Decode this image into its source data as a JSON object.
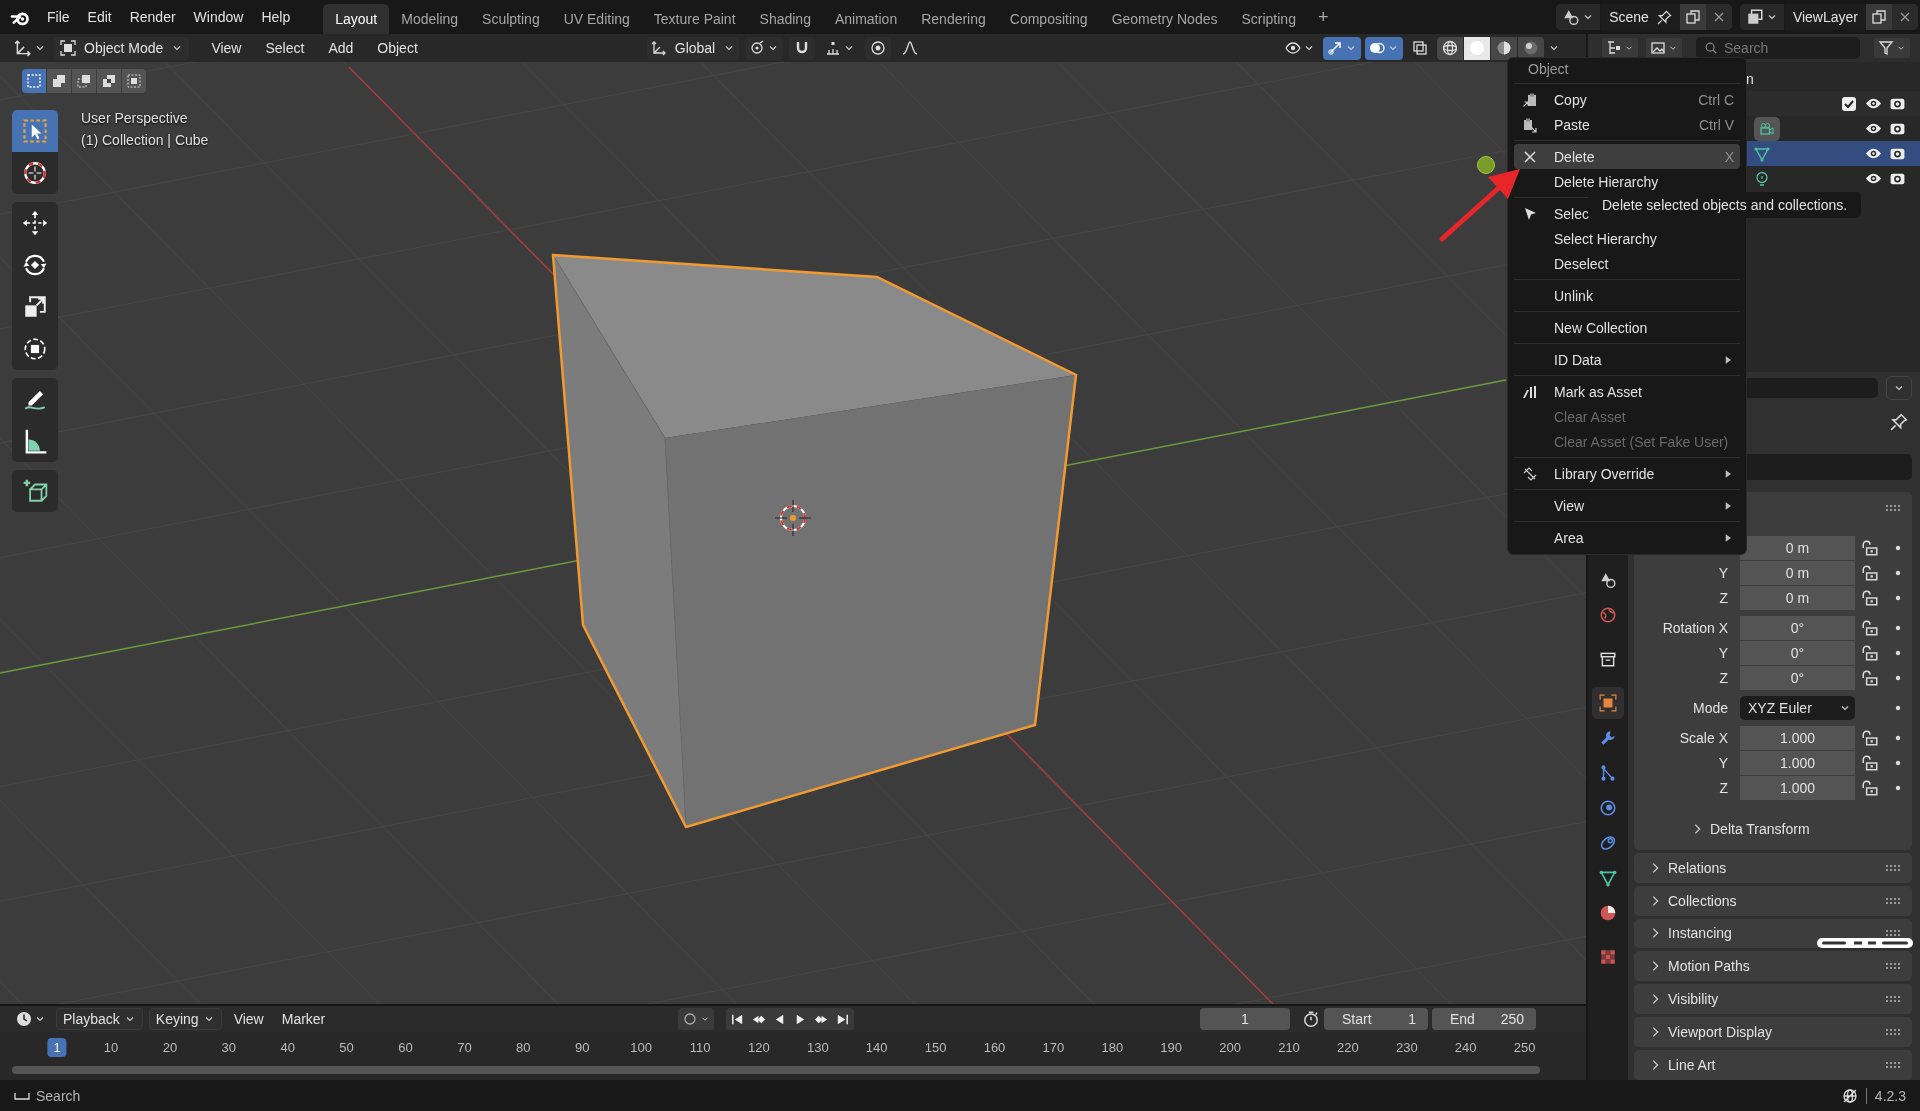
{
  "topbar": {
    "menus": [
      "File",
      "Edit",
      "Render",
      "Window",
      "Help"
    ],
    "workspaces": [
      {
        "label": "Layout",
        "selected": true
      },
      {
        "label": "Modeling",
        "selected": false
      },
      {
        "label": "Sculpting",
        "selected": false
      },
      {
        "label": "UV Editing",
        "selected": false
      },
      {
        "label": "Texture Paint",
        "selected": false
      },
      {
        "label": "Shading",
        "selected": false
      },
      {
        "label": "Animation",
        "selected": false
      },
      {
        "label": "Rendering",
        "selected": false
      },
      {
        "label": "Compositing",
        "selected": false
      },
      {
        "label": "Geometry Nodes",
        "selected": false
      },
      {
        "label": "Scripting",
        "selected": false
      }
    ],
    "add_workspace": "+",
    "scene": "Scene",
    "view_layer": "ViewLayer"
  },
  "viewport": {
    "mode": "Object Mode",
    "menus": [
      "View",
      "Select",
      "Add",
      "Object"
    ],
    "orientation": "Global",
    "toggles": [
      {
        "kind": "visibility",
        "on": false
      },
      {
        "kind": "gizmo",
        "on": true
      },
      {
        "kind": "overlays",
        "on": true
      },
      {
        "kind": "xray",
        "on": false
      }
    ],
    "shading": [
      {
        "kind": "wireframe",
        "selected": false
      },
      {
        "kind": "solid",
        "selected": true
      },
      {
        "kind": "material",
        "selected": false
      },
      {
        "kind": "rendered",
        "selected": false
      }
    ],
    "select_modes": [
      {
        "kind": "new",
        "selected": true
      },
      {
        "kind": "extend",
        "selected": false
      },
      {
        "kind": "subtract",
        "selected": false
      },
      {
        "kind": "invert",
        "selected": false
      },
      {
        "kind": "intersect",
        "selected": false
      }
    ],
    "tool_groups": [
      [
        {
          "kind": "select_box",
          "selected": true
        },
        {
          "kind": "cursor",
          "selected": false
        }
      ],
      [
        {
          "kind": "move",
          "selected": false
        },
        {
          "kind": "rotate",
          "selected": false
        },
        {
          "kind": "scale",
          "selected": false
        },
        {
          "kind": "transform",
          "selected": false
        }
      ],
      [
        {
          "kind": "annotate",
          "selected": false
        },
        {
          "kind": "measure",
          "selected": false
        }
      ],
      [
        {
          "kind": "add_cube",
          "selected": false
        }
      ]
    ],
    "info": [
      "User Perspective",
      "(1) Collection | Cube"
    ]
  },
  "context_menu": {
    "title": "Object",
    "sections": [
      [
        {
          "label": "Copy",
          "shortcut": "Ctrl C",
          "kind": "copy",
          "submenu": false,
          "disabled": false,
          "selected": false
        },
        {
          "label": "Paste",
          "shortcut": "Ctrl V",
          "kind": "paste",
          "submenu": false,
          "disabled": false,
          "selected": false
        }
      ],
      [
        {
          "label": "Delete",
          "shortcut": "X",
          "kind": "delete",
          "submenu": false,
          "disabled": false,
          "selected": true
        },
        {
          "label": "Delete Hierarchy",
          "submenu": false,
          "disabled": false,
          "selected": false
        }
      ],
      [
        {
          "label": "Selec",
          "kind": "select",
          "submenu": false,
          "disabled": false,
          "selected": false
        },
        {
          "label": "Select Hierarchy",
          "submenu": false,
          "disabled": false,
          "selected": false
        },
        {
          "label": "Deselect",
          "submenu": false,
          "disabled": false,
          "selected": false
        }
      ],
      [
        {
          "label": "Unlink",
          "submenu": false,
          "disabled": false,
          "selected": false
        }
      ],
      [
        {
          "label": "New Collection",
          "submenu": false,
          "disabled": false,
          "selected": false
        }
      ],
      [
        {
          "label": "ID Data",
          "submenu": true,
          "disabled": false,
          "selected": false
        }
      ],
      [
        {
          "label": "Mark as Asset",
          "kind": "asset",
          "submenu": false,
          "disabled": false,
          "selected": false
        },
        {
          "label": "Clear Asset",
          "submenu": false,
          "disabled": true,
          "selected": false
        },
        {
          "label": "Clear Asset (Set Fake User)",
          "submenu": false,
          "disabled": true,
          "selected": false
        }
      ],
      [
        {
          "label": "Library Override",
          "kind": "override",
          "submenu": true,
          "disabled": false,
          "selected": false
        }
      ],
      [
        {
          "label": "View",
          "submenu": true,
          "disabled": false,
          "selected": false
        }
      ],
      [
        {
          "label": "Area",
          "submenu": true,
          "disabled": false,
          "selected": false
        }
      ]
    ]
  },
  "tooltip": "Delete selected objects and collections.",
  "outliner": {
    "search_placeholder": "Search",
    "tree": [
      {
        "kind": "scene_collection",
        "label": "n",
        "selected": false,
        "children": [
          {
            "kind": "collection",
            "checked": true,
            "selected": false,
            "children": [
              {
                "kind": "camera",
                "selected": false
              },
              {
                "kind": "mesh",
                "selected": true
              },
              {
                "kind": "light",
                "selected": false
              }
            ]
          }
        ]
      }
    ]
  },
  "properties": {
    "tab_groups": [
      [
        {
          "kind": "scene",
          "selected": false
        },
        {
          "kind": "world",
          "selected": false
        }
      ],
      [
        {
          "kind": "collection",
          "selected": false
        }
      ],
      [
        {
          "kind": "object",
          "selected": true
        },
        {
          "kind": "modifiers",
          "selected": false
        },
        {
          "kind": "particles",
          "selected": false
        },
        {
          "kind": "physics",
          "selected": false
        },
        {
          "kind": "constraints",
          "selected": false
        },
        {
          "kind": "data",
          "selected": false
        },
        {
          "kind": "material",
          "selected": false
        }
      ],
      [
        {
          "kind": "texture",
          "selected": false
        }
      ]
    ],
    "transform": [
      {
        "rows": [
          {
            "kind": "number",
            "value": "0 m"
          },
          {
            "kind": "number",
            "label": "Y",
            "value": "0 m"
          },
          {
            "kind": "number",
            "label": "Z",
            "value": "0 m"
          }
        ]
      },
      {
        "rows": [
          {
            "kind": "number",
            "label": "Rotation X",
            "value": "0°"
          },
          {
            "kind": "number",
            "label": "Y",
            "value": "0°"
          },
          {
            "kind": "number",
            "label": "Z",
            "value": "0°"
          }
        ]
      },
      {
        "rows": [
          {
            "kind": "dropdown",
            "label": "Mode",
            "value": "XYZ Euler"
          }
        ]
      },
      {
        "rows": [
          {
            "kind": "number",
            "label": "Scale X",
            "value": "1.000"
          },
          {
            "kind": "number",
            "label": "Y",
            "value": "1.000"
          },
          {
            "kind": "number",
            "label": "Z",
            "value": "1.000"
          }
        ]
      }
    ],
    "subpanel": "Delta Transform",
    "panels": [
      "Relations",
      "Collections",
      "Instancing",
      "Motion Paths",
      "Visibility",
      "Viewport Display",
      "Line Art"
    ]
  },
  "timeline": {
    "menus": [
      {
        "label": "Playback",
        "dropdown": true
      },
      {
        "label": "Keying",
        "dropdown": true
      },
      {
        "label": "View",
        "dropdown": false
      },
      {
        "label": "Marker",
        "dropdown": false
      }
    ],
    "current_frame": "1",
    "start_label": "Start",
    "start": "1",
    "end_label": "End",
    "end": "250",
    "frames": [
      {
        "label": "1",
        "selected": true
      },
      {
        "label": "10",
        "selected": false
      },
      {
        "label": "20",
        "selected": false
      },
      {
        "label": "30",
        "selected": false
      },
      {
        "label": "40",
        "selected": false
      },
      {
        "label": "50",
        "selected": false
      },
      {
        "label": "60",
        "selected": false
      },
      {
        "label": "70",
        "selected": false
      },
      {
        "label": "80",
        "selected": false
      },
      {
        "label": "90",
        "selected": false
      },
      {
        "label": "100",
        "selected": false
      },
      {
        "label": "110",
        "selected": false
      },
      {
        "label": "120",
        "selected": false
      },
      {
        "label": "130",
        "selected": false
      },
      {
        "label": "140",
        "selected": false
      },
      {
        "label": "150",
        "selected": false
      },
      {
        "label": "160",
        "selected": false
      },
      {
        "label": "170",
        "selected": false
      },
      {
        "label": "180",
        "selected": false
      },
      {
        "label": "190",
        "selected": false
      },
      {
        "label": "200",
        "selected": false
      },
      {
        "label": "210",
        "selected": false
      },
      {
        "label": "220",
        "selected": false
      },
      {
        "label": "230",
        "selected": false
      },
      {
        "label": "240",
        "selected": false
      },
      {
        "label": "250",
        "selected": false
      }
    ]
  },
  "status_bar": {
    "hint": "Search",
    "version": "4.2.3"
  }
}
